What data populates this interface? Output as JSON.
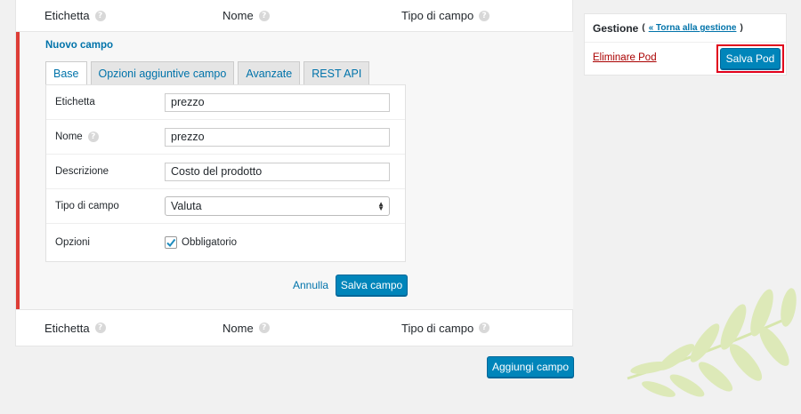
{
  "columns": {
    "label": "Etichetta",
    "name": "Nome",
    "type": "Tipo di campo"
  },
  "edit": {
    "title": "Nuovo campo",
    "tabs": [
      "Base",
      "Opzioni aggiuntive campo",
      "Avanzate",
      "REST API"
    ],
    "fields": {
      "label_label": "Etichetta",
      "label_value": "prezzo",
      "name_label": "Nome",
      "name_value": "prezzo",
      "desc_label": "Descrizione",
      "desc_value": "Costo del prodotto",
      "type_label": "Tipo di campo",
      "type_value": "Valuta",
      "options_label": "Opzioni",
      "required_label": "Obbligatorio",
      "required_checked": true
    },
    "cancel": "Annulla",
    "save_field": "Salva campo"
  },
  "add_field": "Aggiungi campo",
  "sidebar": {
    "title": "Gestione",
    "back_link": "« Torna alla gestione",
    "delete": "Eliminare Pod",
    "save": "Salva Pod"
  },
  "colors": {
    "accent": "#0085ba",
    "error": "#dd3d36",
    "highlight": "#e0001b"
  }
}
